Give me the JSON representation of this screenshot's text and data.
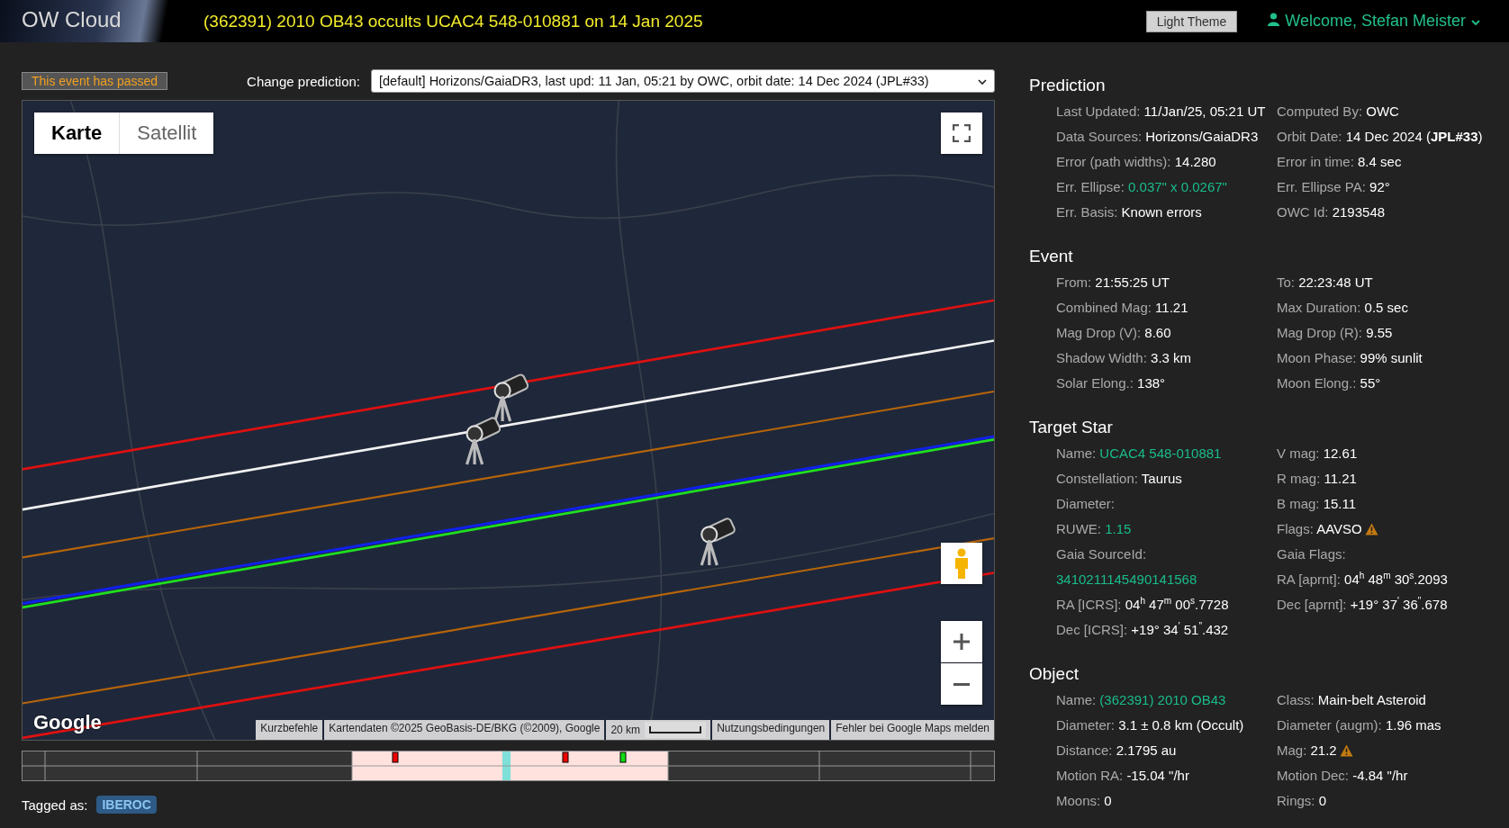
{
  "header": {
    "logo": "OW Cloud",
    "title": "(362391) 2010 OB43 occults UCAC4 548-010881 on 14 Jan 2025",
    "theme_button": "Light Theme",
    "welcome": "Welcome, Stefan Meister"
  },
  "status_badge": "This event has passed",
  "prediction_select": {
    "label": "Change prediction:",
    "value": "[default] Horizons/GaiaDR3, last upd: 11 Jan, 05:21 by OWC, orbit date: 14 Dec 2024 (JPL#33)"
  },
  "map": {
    "map_types": [
      {
        "label": "Karte",
        "selected": true
      },
      {
        "label": "Satellit",
        "selected": false
      }
    ],
    "logo": "Google",
    "attribution": [
      "Kurzbefehle",
      "Kartendaten ©2025 GeoBasis-DE/BKG (©2009), Google"
    ],
    "scale": "20 km",
    "links": [
      "Nutzungsbedingungen",
      "Fehler bei Google Maps melden"
    ]
  },
  "tagged": {
    "label": "Tagged as:",
    "tags": [
      "IBEROC"
    ]
  },
  "sections": [
    {
      "title": "Prediction",
      "left": [
        {
          "label": "Last Updated:",
          "value": "11/Jan/25, 05:21 UT",
          "kind": "text",
          "warning": false
        },
        {
          "label": "Data Sources:",
          "value": "Horizons/GaiaDR3",
          "kind": "text",
          "warning": false
        },
        {
          "label": "Error (path widths):",
          "value": "14.280",
          "kind": "text",
          "warning": false
        },
        {
          "label": "Err. Ellipse:",
          "value": "0.037\" x 0.0267\"",
          "kind": "link",
          "warning": false
        },
        {
          "label": "Err. Basis:",
          "value": "Known errors",
          "kind": "text",
          "warning": false
        }
      ],
      "right": [
        {
          "label": "Computed By:",
          "value": "OWC",
          "kind": "text",
          "warning": false
        },
        {
          "label": "Orbit Date:",
          "value": "14 Dec 2024 (**JPL#33**)",
          "kind": "text",
          "warning": false
        },
        {
          "label": "Error in time:",
          "value": "8.4 sec",
          "kind": "text",
          "warning": false
        },
        {
          "label": "Err. Ellipse PA:",
          "value": "92°",
          "kind": "text",
          "warning": false
        },
        {
          "label": "OWC Id:",
          "value": "2193548",
          "kind": "text",
          "warning": false
        }
      ]
    },
    {
      "title": "Event",
      "left": [
        {
          "label": "From:",
          "value": "21:55:25 UT",
          "kind": "text",
          "warning": false
        },
        {
          "label": "Combined Mag:",
          "value": "11.21",
          "kind": "text",
          "warning": false
        },
        {
          "label": "Mag Drop (V):",
          "value": "8.60",
          "kind": "text",
          "warning": false
        },
        {
          "label": "Shadow Width:",
          "value": "3.3 km",
          "kind": "text",
          "warning": false
        },
        {
          "label": "Solar Elong.:",
          "value": "138°",
          "kind": "text",
          "warning": false
        }
      ],
      "right": [
        {
          "label": "To:",
          "value": "22:23:48 UT",
          "kind": "text",
          "warning": false
        },
        {
          "label": "Max Duration:",
          "value": "0.5 sec",
          "kind": "text",
          "warning": false
        },
        {
          "label": "Mag Drop (R):",
          "value": "9.55",
          "kind": "text",
          "warning": false
        },
        {
          "label": "Moon Phase:",
          "value": "99% sunlit",
          "kind": "text",
          "warning": false
        },
        {
          "label": "Moon Elong.:",
          "value": "55°",
          "kind": "text",
          "warning": false
        }
      ]
    },
    {
      "title": "Target Star",
      "left": [
        {
          "label": "Name:",
          "value": "UCAC4 548-010881",
          "kind": "link",
          "warning": false
        },
        {
          "label": "Constellation:",
          "value": "Taurus",
          "kind": "text",
          "warning": false
        },
        {
          "label": "Diameter:",
          "kind": "text",
          "warning": false
        },
        {
          "label": "RUWE:",
          "value": "1.15",
          "kind": "link",
          "warning": false
        },
        {
          "label": "Gaia SourceId:",
          "value": "3410211145490141568",
          "kind": "link-block",
          "warning": false
        },
        {
          "label": "RA [ICRS]:",
          "value": "04$^{h}$ 47$^{m}$ 00$^{s}$.7728",
          "kind": "text",
          "warning": false
        },
        {
          "label": "Dec [ICRS]:",
          "value": "+19° 34$^{'}$ 51$^{\"}$.432",
          "kind": "text",
          "warning": false
        }
      ],
      "right": [
        {
          "label": "V mag:",
          "value": "12.61",
          "kind": "text",
          "warning": false
        },
        {
          "label": "R mag:",
          "value": "11.21",
          "kind": "text",
          "warning": false
        },
        {
          "label": "B mag:",
          "value": "15.11",
          "kind": "text",
          "warning": false
        },
        {
          "label": "Flags:",
          "value": "AAVSO",
          "kind": "text",
          "warning": true
        },
        {
          "label": "Gaia Flags:",
          "kind": "text",
          "warning": false
        },
        {
          "label": "RA [aprnt]:",
          "value": "04$^{h}$ 48$^{m}$ 30$^{s}$.2093",
          "kind": "text",
          "warning": false
        },
        {
          "label": "Dec [aprnt]:",
          "value": "+19° 37$^{'}$ 36$^{\"}$.678",
          "kind": "text",
          "warning": false
        }
      ]
    },
    {
      "title": "Object",
      "left": [
        {
          "label": "Name:",
          "value": "(362391) 2010 OB43",
          "kind": "link",
          "warning": false
        },
        {
          "label": "Diameter:",
          "value": "3.1 ± 0.8 km  (Occult)",
          "kind": "text",
          "warning": false
        },
        {
          "label": "Distance:",
          "value": "2.1795 au",
          "kind": "text",
          "warning": false
        },
        {
          "label": "Motion RA:",
          "value": "-15.04 \"/hr",
          "kind": "text",
          "warning": false
        },
        {
          "label": "Moons:",
          "value": "0",
          "kind": "text",
          "warning": false
        }
      ],
      "right": [
        {
          "label": "Class:",
          "value": "Main-belt Asteroid",
          "kind": "text",
          "warning": false
        },
        {
          "label": "Diameter (augm):",
          "value": "1.96 mas",
          "kind": "text",
          "warning": false
        },
        {
          "label": "Mag:",
          "value": "21.2",
          "kind": "text",
          "warning": true
        },
        {
          "label": "Motion Dec:",
          "value": "-4.84 \"/hr",
          "kind": "text",
          "warning": false
        },
        {
          "label": "Rings:",
          "value": "0",
          "kind": "text",
          "warning": false
        }
      ]
    }
  ]
}
